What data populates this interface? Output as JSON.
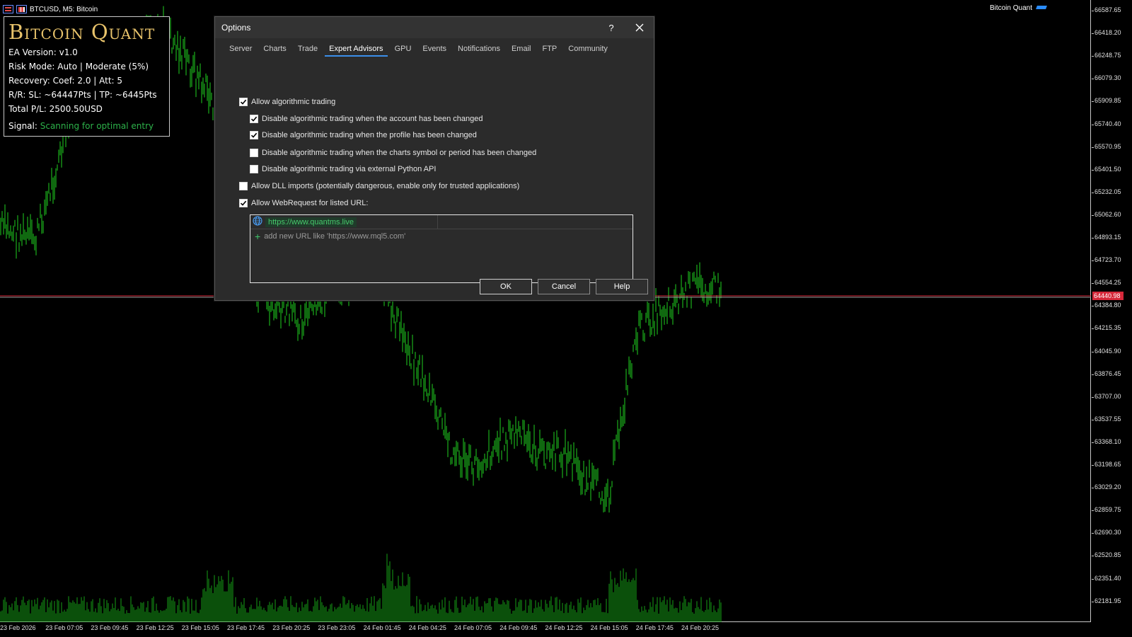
{
  "chart": {
    "symbol_label": "BTCUSD, M5:  Bitcoin",
    "ea_badge": "Bitcoin Quant",
    "current_price": "64440.98",
    "price_ticks": [
      "66587.65",
      "66418.20",
      "66248.75",
      "66079.30",
      "65909.85",
      "65740.40",
      "65570.95",
      "65401.50",
      "65232.05",
      "65062.60",
      "64893.15",
      "64723.70",
      "64554.25",
      "64384.80",
      "64215.35",
      "64045.90",
      "63876.45",
      "63707.00",
      "63537.55",
      "63368.10",
      "63198.65",
      "63029.20",
      "62859.75",
      "62690.30",
      "62520.85",
      "62351.40",
      "62181.95"
    ],
    "time_ticks": [
      "23 Feb 2026",
      "23 Feb 07:05",
      "23 Feb 09:45",
      "23 Feb 12:25",
      "23 Feb 15:05",
      "23 Feb 17:45",
      "23 Feb 20:25",
      "23 Feb 23:05",
      "24 Feb 01:45",
      "24 Feb 04:25",
      "24 Feb 07:05",
      "24 Feb 09:45",
      "24 Feb 12:25",
      "24 Feb 15:05",
      "24 Feb 17:45",
      "24 Feb 20:25"
    ],
    "colors": {
      "bars": "#1fd21f",
      "volume": "#16a116",
      "price_line": "#d6283a"
    }
  },
  "ea_panel": {
    "title": "Bitcoin Quant",
    "version": "EA Version: v1.0",
    "risk_mode": "Risk Mode: Auto | Moderate (5%)",
    "recovery": "Recovery: Coef: 2.0 | Att: 5",
    "rr": "R/R: SL: ~64447Pts | TP: ~6445Pts",
    "total_pl": "Total P/L: 2500.50USD",
    "signal_label": "Signal:",
    "signal_value": "Scanning for optimal entry"
  },
  "dialog": {
    "title": "Options",
    "help_glyph": "?",
    "tabs": [
      {
        "label": "Server"
      },
      {
        "label": "Charts"
      },
      {
        "label": "Trade"
      },
      {
        "label": "Expert Advisors",
        "active": true
      },
      {
        "label": "GPU"
      },
      {
        "label": "Events"
      },
      {
        "label": "Notifications"
      },
      {
        "label": "Email"
      },
      {
        "label": "FTP"
      },
      {
        "label": "Community"
      }
    ],
    "options": [
      {
        "label": "Allow algorithmic trading",
        "checked": true
      },
      {
        "label": "Disable algorithmic trading when the account has been changed",
        "checked": true
      },
      {
        "label": "Disable algorithmic trading when the profile has been changed",
        "checked": true
      },
      {
        "label": "Disable algorithmic trading when the charts symbol or period has been changed",
        "checked": false
      },
      {
        "label": "Disable algorithmic trading via external Python API",
        "checked": false
      },
      {
        "label": "Allow DLL imports (potentially dangerous, enable only for trusted applications)",
        "checked": false
      },
      {
        "label": "Allow WebRequest for listed URL:",
        "checked": true
      }
    ],
    "url_list": {
      "entries": [
        "https://www.quantms.live"
      ],
      "add_placeholder": "add new URL like 'https://www.mql5.com'"
    },
    "buttons": {
      "ok": "OK",
      "cancel": "Cancel",
      "help": "Help"
    }
  }
}
